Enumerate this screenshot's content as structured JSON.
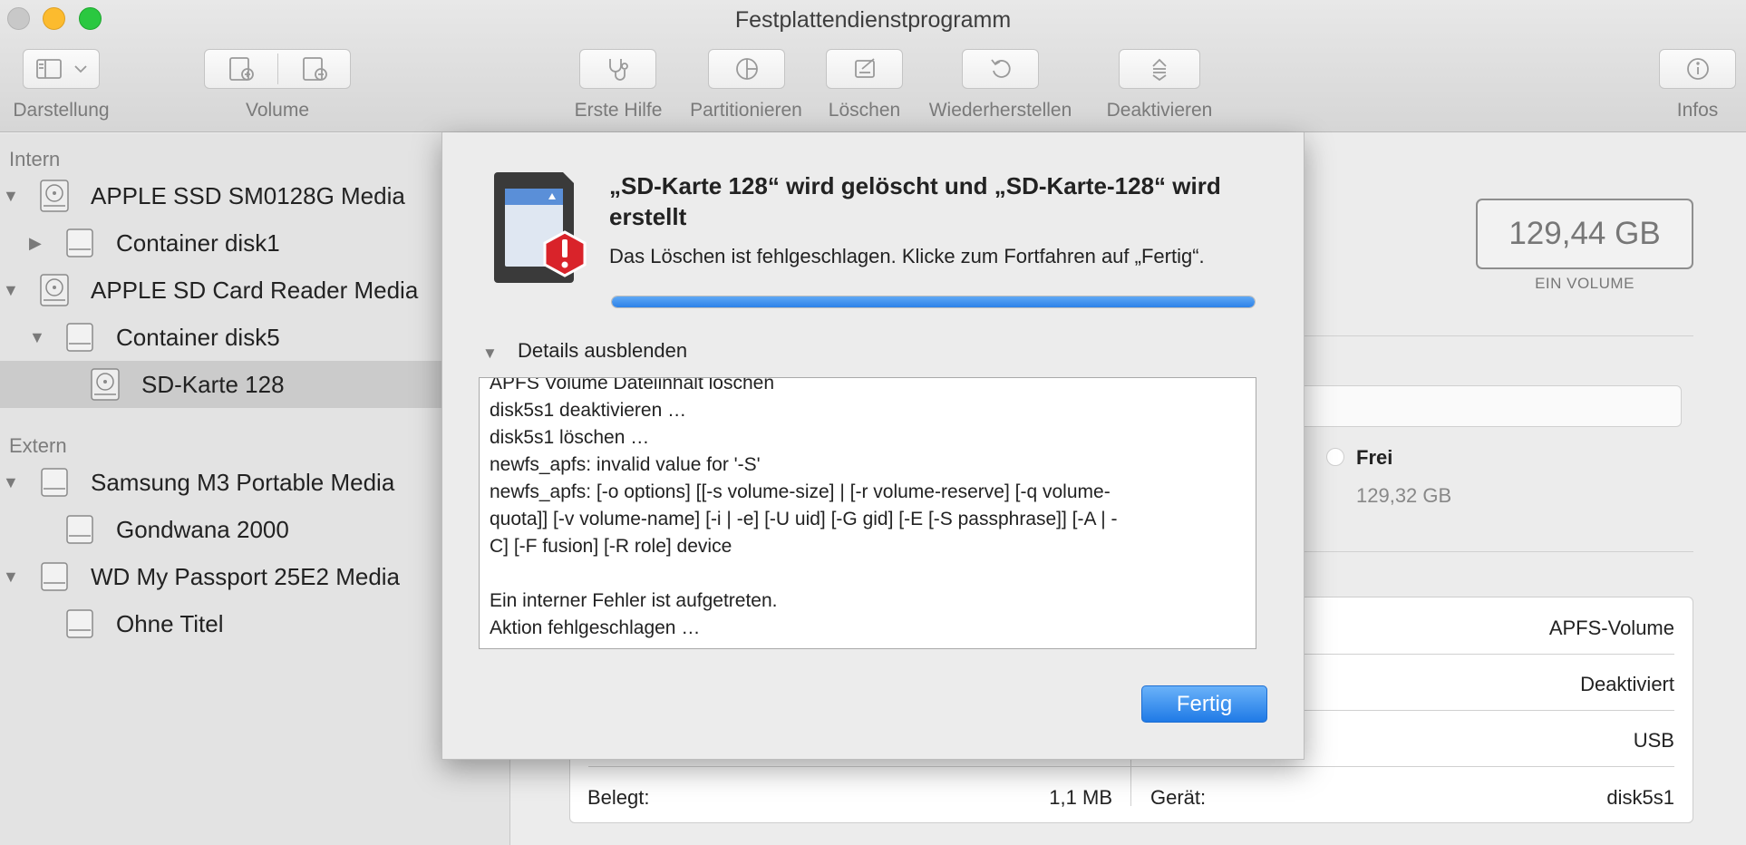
{
  "window": {
    "title": "Festplattendienstprogramm"
  },
  "toolbar": {
    "darstellung": "Darstellung",
    "volume": "Volume",
    "erste_hilfe": "Erste Hilfe",
    "partitionieren": "Partitionieren",
    "loeschen": "Löschen",
    "wiederherstellen": "Wiederherstellen",
    "deaktivieren": "Deaktivieren",
    "infos": "Infos"
  },
  "sidebar": {
    "intern_header": "Intern",
    "extern_header": "Extern",
    "items": [
      {
        "label": "APPLE SSD SM0128G Media"
      },
      {
        "label": "Container disk1"
      },
      {
        "label": "APPLE SD Card Reader Media"
      },
      {
        "label": "Container disk5"
      },
      {
        "label": "SD-Karte 128"
      },
      {
        "label": "Samsung M3 Portable Media"
      },
      {
        "label": "Gondwana 2000"
      },
      {
        "label": "WD My Passport 25E2 Media"
      },
      {
        "label": "Ohne Titel"
      }
    ]
  },
  "main": {
    "capacity": "129,44 GB",
    "capacity_sub": "EIN VOLUME",
    "frei_label": "Frei",
    "frei_value": "129,32 GB",
    "info_rows": {
      "type": "APFS-Volume",
      "mount": "Deaktiviert",
      "connection": "USB",
      "belegt_label": "Belegt:",
      "belegt_value": "1,1 MB",
      "geraet_label": "Gerät:",
      "geraet_value": "disk5s1"
    }
  },
  "dialog": {
    "title": "„SD-Karte 128“ wird gelöscht und „SD-Karte-128“ wird erstellt",
    "message": "Das Löschen ist fehlgeschlagen. Klicke zum Fortfahren auf „Fertig“.",
    "progress": 1.0,
    "details_toggle": "Details ausblenden",
    "log": [
      "APFS Volume Dateiinhalt löschen",
      "disk5s1 deaktivieren …",
      "disk5s1 löschen …",
      "newfs_apfs: invalid value for '-S'",
      "newfs_apfs: [-o options] [[-s volume-size] | [-r volume-reserve] [-q volume-",
      "quota]] [-v volume-name] [-i | -e] [-U uid] [-G gid] [-E [-S passphrase]] [-A | -",
      "C] [-F fusion] [-R role] device",
      "",
      "Ein interner Fehler ist aufgetreten.",
      "Aktion fehlgeschlagen …"
    ],
    "done_button": "Fertig"
  }
}
